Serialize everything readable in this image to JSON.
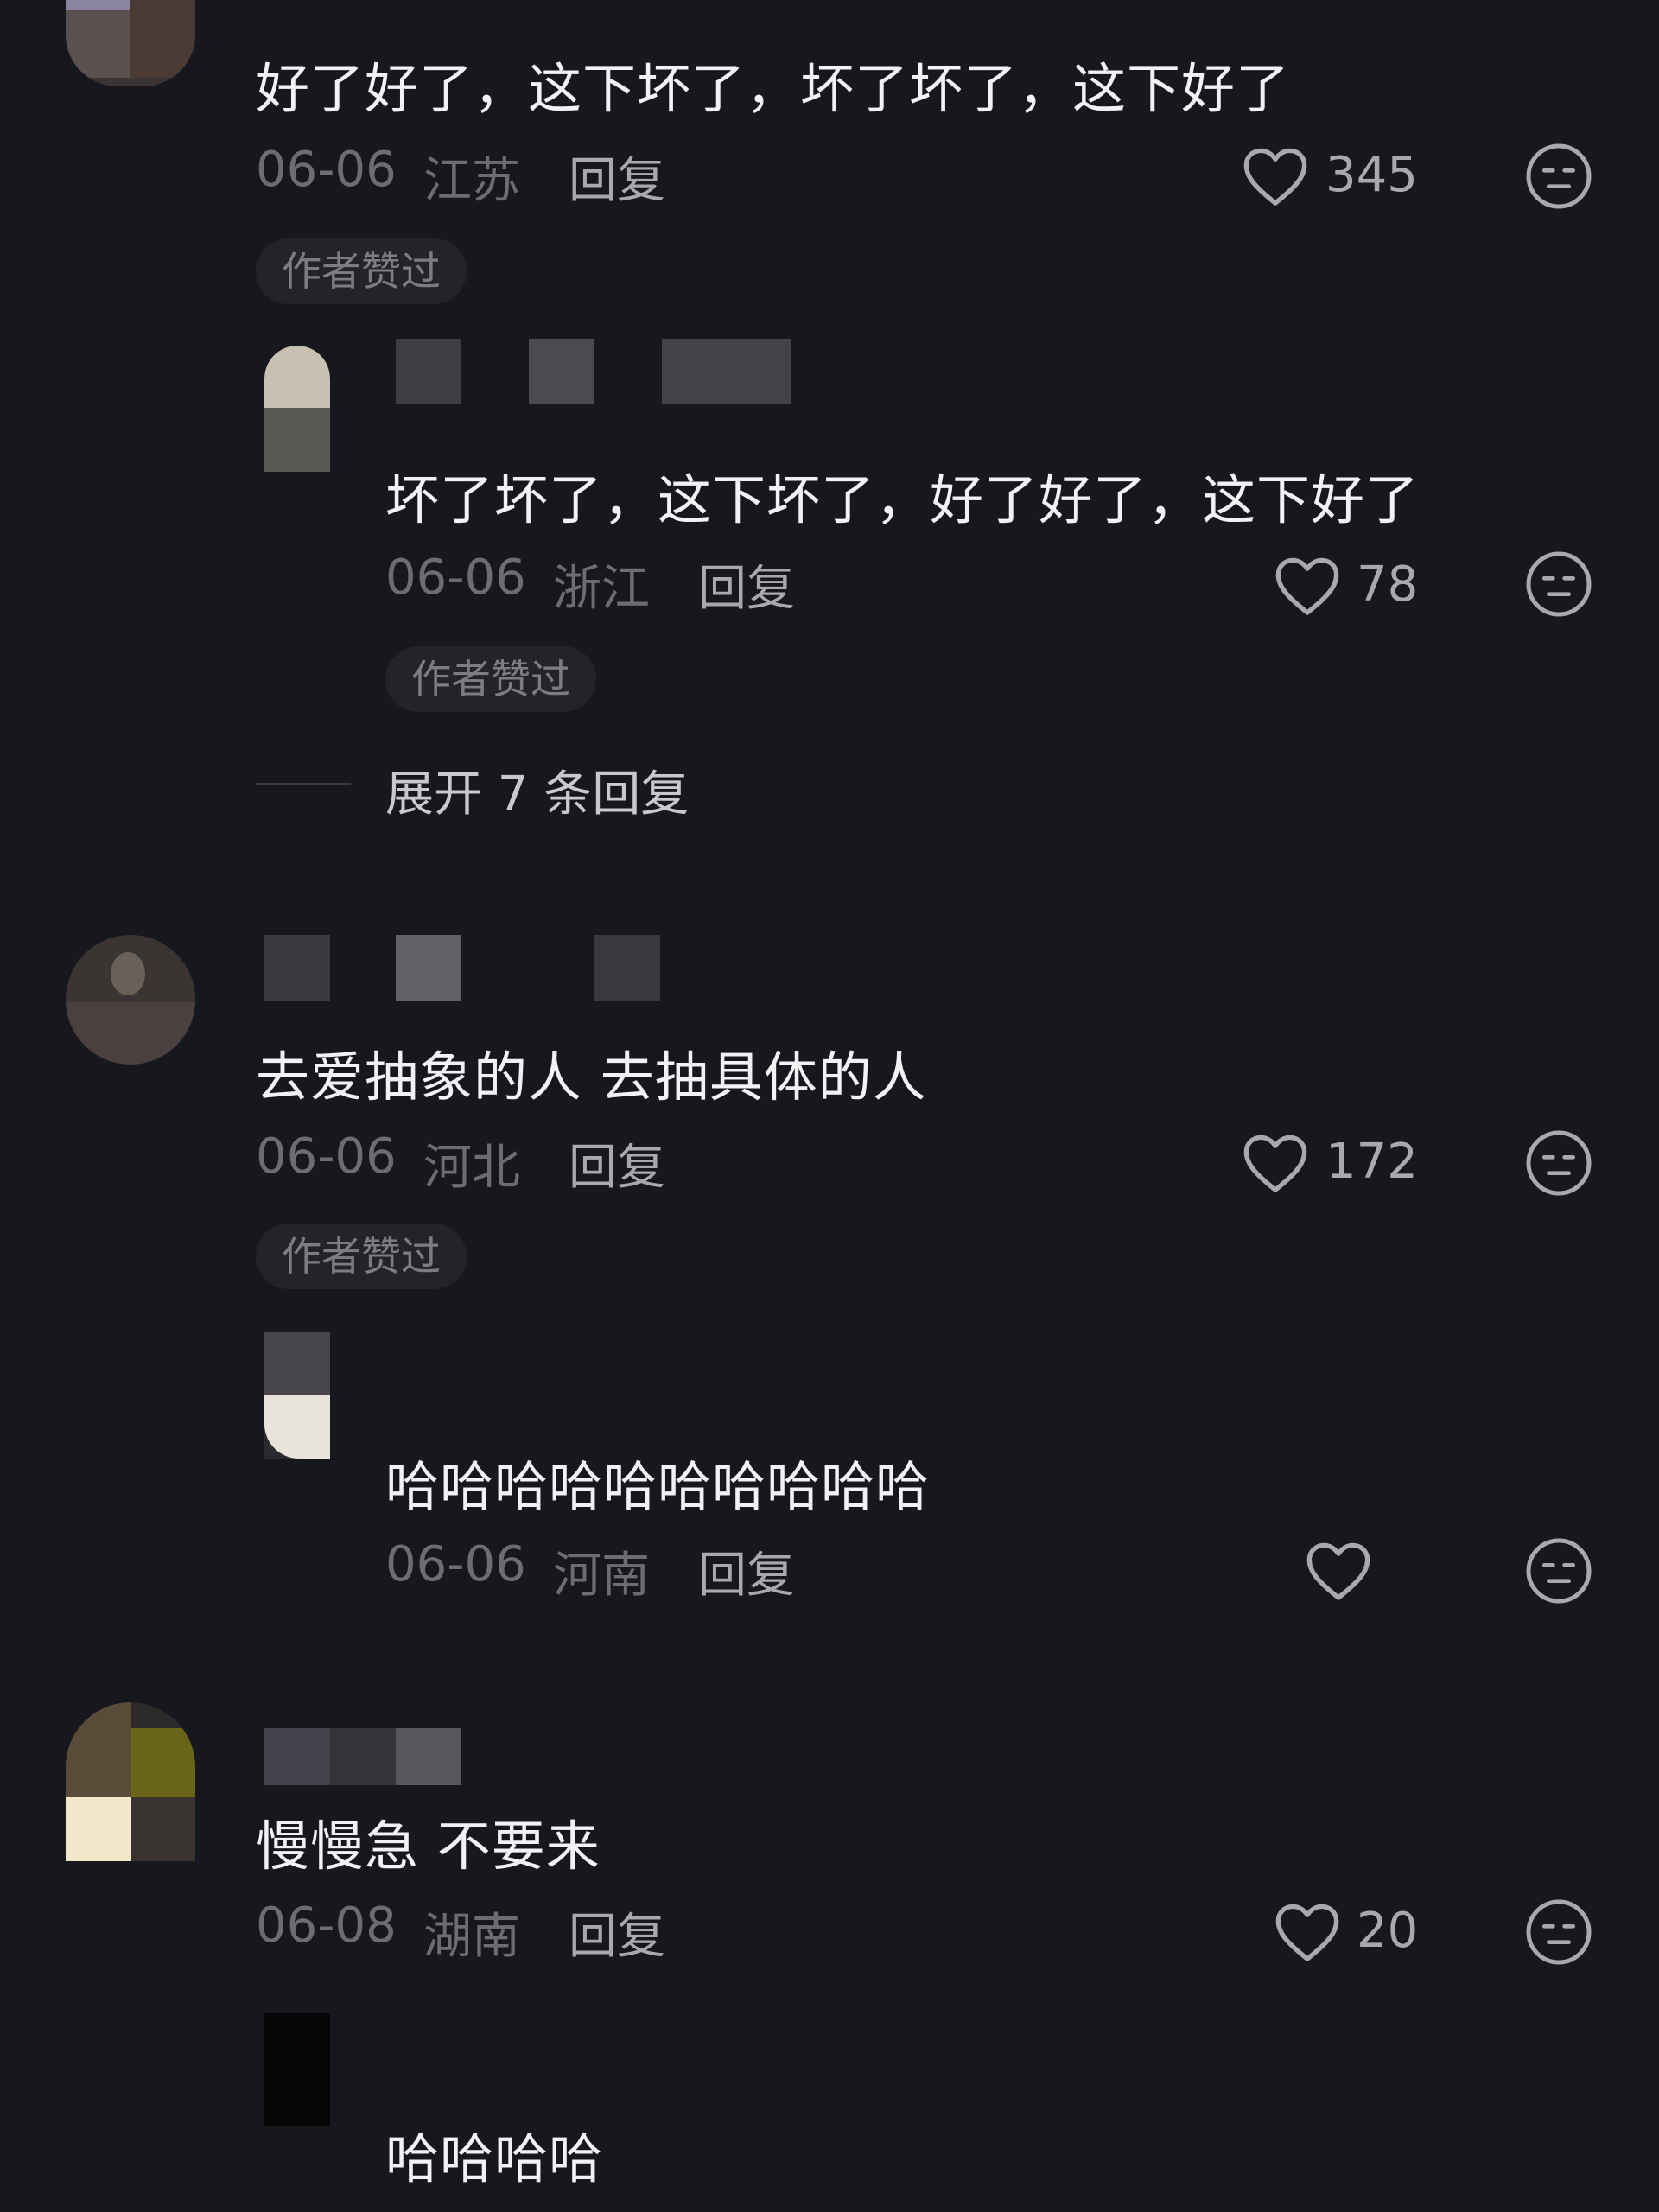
{
  "icons": {
    "like": "heart-outline-icon",
    "dislike": "neutral-face-icon"
  },
  "colors": {
    "background": "#17171e",
    "text": "#f2f2f4",
    "meta": "#6c6c74",
    "secondary": "#a8a8b0",
    "badge_bg": "#232329"
  },
  "comments": [
    {
      "text": "好了好了，这下坏了，坏了坏了，这下好了",
      "date": "06-06",
      "location": "江苏",
      "reply_label": "回复",
      "likes": "345",
      "badge": "作者赞过",
      "replies": [
        {
          "text": "坏了坏了，这下坏了，好了好了，这下好了",
          "date": "06-06",
          "location": "浙江",
          "reply_label": "回复",
          "likes": "78",
          "badge": "作者赞过"
        }
      ],
      "expand_label": "展开 7 条回复"
    },
    {
      "text": "去爱抽象的人 去抽具体的人",
      "date": "06-06",
      "location": "河北",
      "reply_label": "回复",
      "likes": "172",
      "badge": "作者赞过",
      "replies": [
        {
          "text": "哈哈哈哈哈哈哈哈哈哈",
          "date": "06-06",
          "location": "河南",
          "reply_label": "回复",
          "likes": ""
        }
      ]
    },
    {
      "text": "慢慢急 不要来",
      "date": "06-08",
      "location": "湖南",
      "reply_label": "回复",
      "likes": "20",
      "replies": [
        {
          "text": "哈哈哈哈"
        }
      ]
    }
  ]
}
